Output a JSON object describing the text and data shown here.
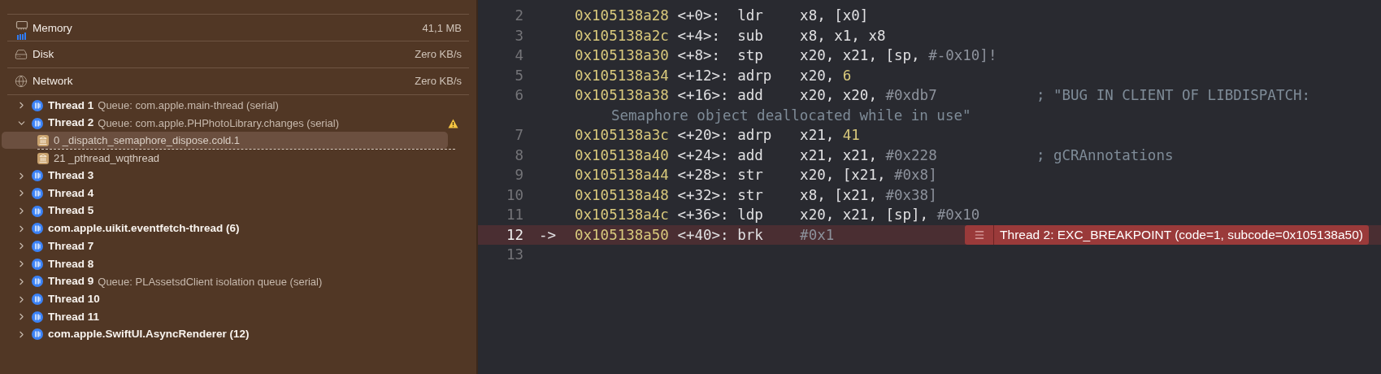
{
  "gauges": [
    {
      "kind": "memory",
      "label": "Memory",
      "value": "41,1 MB"
    },
    {
      "kind": "disk",
      "label": "Disk",
      "value": "Zero KB/s"
    },
    {
      "kind": "network",
      "label": "Network",
      "value": "Zero KB/s"
    }
  ],
  "threads": [
    {
      "name": "Thread 1",
      "queue": "Queue: com.apple.main-thread (serial)",
      "expanded": false,
      "warning": false
    },
    {
      "name": "Thread 2",
      "queue": "Queue: com.apple.PHPhotoLibrary.changes (serial)",
      "expanded": true,
      "warning": true,
      "frames": [
        {
          "label": "0 _dispatch_semaphore_dispose.cold.1",
          "selected": true,
          "hidden_frames_after": true
        },
        {
          "label": "21 _pthread_wqthread",
          "selected": false,
          "hidden_frames_after": false
        }
      ]
    },
    {
      "name": "Thread 3",
      "expanded": false,
      "warning": false
    },
    {
      "name": "Thread 4",
      "expanded": false,
      "warning": false
    },
    {
      "name": "Thread 5",
      "expanded": false,
      "warning": false
    },
    {
      "name": "com.apple.uikit.eventfetch-thread (6)",
      "expanded": false,
      "warning": false
    },
    {
      "name": "Thread 7",
      "expanded": false,
      "warning": false
    },
    {
      "name": "Thread 8",
      "expanded": false,
      "warning": false
    },
    {
      "name": "Thread 9",
      "queue": "Queue: PLAssetsdClient isolation queue (serial)",
      "expanded": false,
      "warning": false
    },
    {
      "name": "Thread 10",
      "expanded": false,
      "warning": false
    },
    {
      "name": "Thread 11",
      "expanded": false,
      "warning": false
    },
    {
      "name": "com.apple.SwiftUI.AsyncRenderer (12)",
      "expanded": false,
      "warning": false
    }
  ],
  "code_lines": [
    {
      "number": "2",
      "current": false,
      "address": "0x105138a28",
      "offset": "<+0>:",
      "mnemonic": "ldr",
      "operands": [
        {
          "text": "x8, [x0]",
          "kind": "reg"
        }
      ]
    },
    {
      "number": "3",
      "current": false,
      "address": "0x105138a2c",
      "offset": "<+4>:",
      "mnemonic": "sub",
      "operands": [
        {
          "text": "x8, x1, x8",
          "kind": "reg"
        }
      ]
    },
    {
      "number": "4",
      "current": false,
      "address": "0x105138a30",
      "offset": "<+8>:",
      "mnemonic": "stp",
      "operands": [
        {
          "text": "x20, x21, [sp, ",
          "kind": "reg"
        },
        {
          "text": "#-0x10]!",
          "kind": "imm"
        }
      ]
    },
    {
      "number": "5",
      "current": false,
      "address": "0x105138a34",
      "offset": "<+12>:",
      "mnemonic": "adrp",
      "operands": [
        {
          "text": "x20, ",
          "kind": "reg"
        },
        {
          "text": "6",
          "kind": "num"
        }
      ]
    },
    {
      "number": "6",
      "current": false,
      "address": "0x105138a38",
      "offset": "<+16>:",
      "mnemonic": "add",
      "operands": [
        {
          "text": "x20, x20, ",
          "kind": "reg"
        },
        {
          "text": "#0xdb7",
          "kind": "imm"
        }
      ],
      "comment": "; \"BUG IN CLIENT OF LIBDISPATCH:",
      "continuation": "Semaphore object deallocated while in use\""
    },
    {
      "number": "7",
      "current": false,
      "address": "0x105138a3c",
      "offset": "<+20>:",
      "mnemonic": "adrp",
      "operands": [
        {
          "text": "x21, ",
          "kind": "reg"
        },
        {
          "text": "41",
          "kind": "num"
        }
      ]
    },
    {
      "number": "8",
      "current": false,
      "address": "0x105138a40",
      "offset": "<+24>:",
      "mnemonic": "add",
      "operands": [
        {
          "text": "x21, x21, ",
          "kind": "reg"
        },
        {
          "text": "#0x228",
          "kind": "imm"
        }
      ],
      "comment": "; gCRAnnotations"
    },
    {
      "number": "9",
      "current": false,
      "address": "0x105138a44",
      "offset": "<+28>:",
      "mnemonic": "str",
      "operands": [
        {
          "text": "x20, [x21, ",
          "kind": "reg"
        },
        {
          "text": "#0x8]",
          "kind": "imm"
        }
      ]
    },
    {
      "number": "10",
      "current": false,
      "address": "0x105138a48",
      "offset": "<+32>:",
      "mnemonic": "str",
      "operands": [
        {
          "text": "x8, [x21, ",
          "kind": "reg"
        },
        {
          "text": "#0x38]",
          "kind": "imm"
        }
      ]
    },
    {
      "number": "11",
      "current": false,
      "address": "0x105138a4c",
      "offset": "<+36>:",
      "mnemonic": "ldp",
      "operands": [
        {
          "text": "x20, x21, [sp], ",
          "kind": "reg"
        },
        {
          "text": "#0x10",
          "kind": "imm"
        }
      ]
    },
    {
      "number": "12",
      "current": true,
      "arrow": "->",
      "address": "0x105138a50",
      "offset": "<+40>:",
      "mnemonic": "brk",
      "operands": [
        {
          "text": "#0x1",
          "kind": "imm"
        }
      ],
      "annotation": "Thread 2: EXC_BREAKPOINT (code=1, subcode=0x105138a50)"
    },
    {
      "number": "13",
      "current": false
    }
  ]
}
